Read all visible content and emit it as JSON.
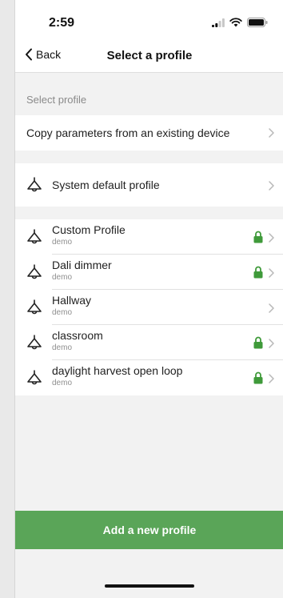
{
  "status_bar": {
    "time": "2:59"
  },
  "nav": {
    "back_label": "Back",
    "title": "Select a profile"
  },
  "section": {
    "header": "Select profile"
  },
  "copy_row": {
    "label": "Copy parameters from an existing device"
  },
  "default_row": {
    "label": "System default profile"
  },
  "profiles": [
    {
      "name": "Custom Profile",
      "owner": "demo",
      "locked": true
    },
    {
      "name": "Dali dimmer",
      "owner": "demo",
      "locked": true
    },
    {
      "name": "Hallway",
      "owner": "demo",
      "locked": false
    },
    {
      "name": "classroom",
      "owner": "demo",
      "locked": true
    },
    {
      "name": "daylight harvest open loop",
      "owner": "demo",
      "locked": true
    }
  ],
  "footer": {
    "add_button_label": "Add a new profile"
  },
  "colors": {
    "accent_green": "#5aa558",
    "lock_green": "#3f9a3a"
  },
  "icons": {
    "lamp": "pendant-lamp-icon",
    "lock": "lock-icon",
    "chevron": "chevron-right-icon",
    "back": "chevron-left-icon"
  }
}
